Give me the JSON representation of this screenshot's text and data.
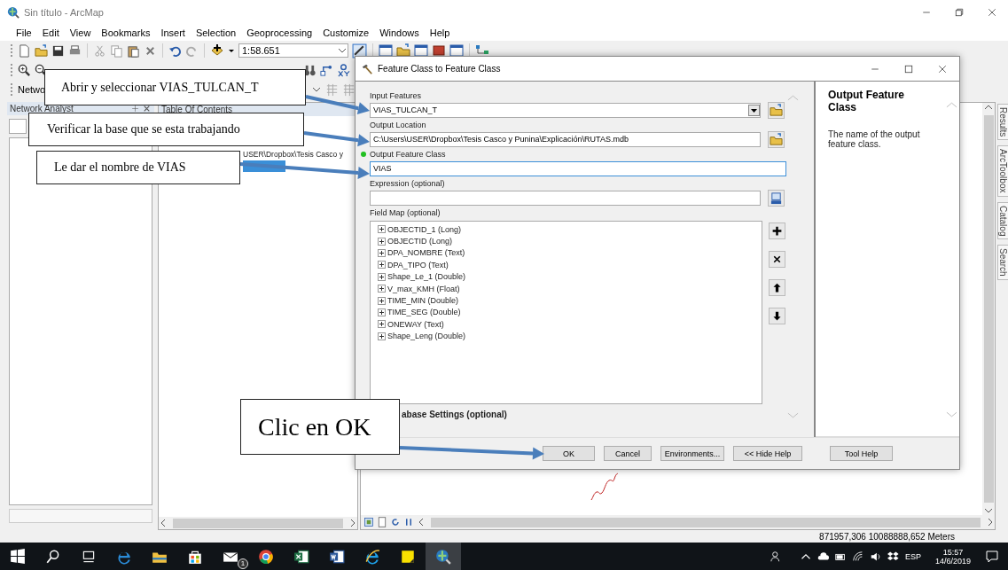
{
  "window": {
    "title": "Sin título - ArcMap"
  },
  "menu": [
    "File",
    "Edit",
    "View",
    "Bookmarks",
    "Insert",
    "Selection",
    "Geoprocessing",
    "Customize",
    "Windows",
    "Help"
  ],
  "toolbar": {
    "scale": "1:58.651",
    "network_combo": "Netwo"
  },
  "network_analyst": {
    "title": "Network Analyst"
  },
  "toc": {
    "title": "Table Of Contents",
    "path": "USER\\Dropbox\\Tesis Casco y"
  },
  "side_tabs": [
    "Results",
    "ArcToolbox",
    "Catalog",
    "Search"
  ],
  "status_bar": {
    "coordinates": "871957,306  10088888,652 Meters"
  },
  "dialog": {
    "title": "Feature Class to Feature Class",
    "params": [
      {
        "label": "Input Features",
        "value": "VIAS_TULCAN_T",
        "kind": "dropdown",
        "focused": false
      },
      {
        "label": "Output Location",
        "value": "C:\\Users\\USER\\Dropbox\\Tesis Casco y Punina\\Explicación\\RUTAS.mdb",
        "kind": "folder",
        "focused": false
      },
      {
        "label": "Output Feature Class",
        "value": "VIAS",
        "kind": "text",
        "focused": true
      },
      {
        "label": "Expression (optional)",
        "kind": "sql",
        "focused": false
      }
    ],
    "field_map": {
      "label": "Field Map (optional)",
      "fields": [
        {
          "name": "OBJECTID_1 (Long)",
          "expanded": false
        },
        {
          "name": "OBJECTID (Long)",
          "expanded": false
        },
        {
          "name": "DPA_NOMBRE (Text)",
          "expanded": false
        },
        {
          "name": "DPA_TIPO (Text)",
          "expanded": false
        },
        {
          "name": "Shape_Le_1 (Double)",
          "expanded": false
        },
        {
          "name": "V_max_KMH (Float)",
          "expanded": false
        },
        {
          "name": "TIME_MIN (Double)",
          "expanded": false
        },
        {
          "name": "TIME_SEG (Double)",
          "expanded": false
        },
        {
          "name": "ONEWAY (Text)",
          "expanded": false
        },
        {
          "name": "Shape_Leng (Double)",
          "expanded": false
        }
      ]
    },
    "section": "abase Settings (optional)",
    "buttons": [
      "OK",
      "Cancel",
      "Environments...",
      "<< Hide Help",
      "Tool Help"
    ],
    "help": {
      "title": "Output Feature Class",
      "text": "The name of the output feature class."
    }
  },
  "callouts": [
    {
      "text": "Abrir y seleccionar VIAS_TULCAN_T"
    },
    {
      "text": "Verificar la base que se esta trabajando"
    },
    {
      "text": "Le dar el nombre de VIAS"
    },
    {
      "text": "Clic en OK"
    }
  ],
  "taskbar": {
    "mail_badge": "1",
    "language": "ESP",
    "time": "15:57",
    "date": "14/6/2019"
  }
}
